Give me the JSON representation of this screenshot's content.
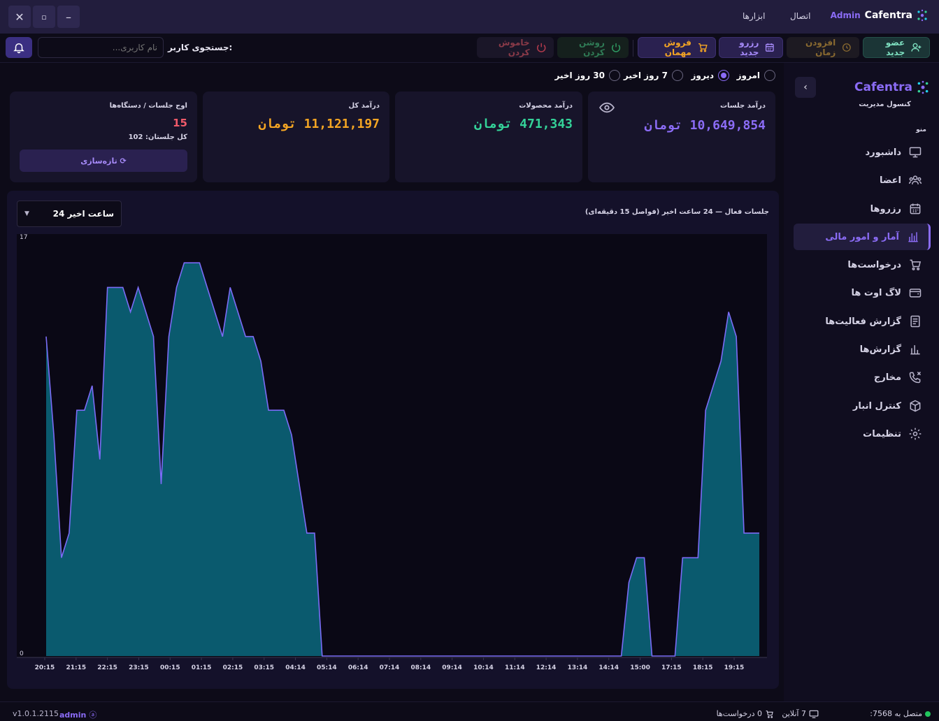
{
  "titlebar": {
    "brand_name": "Cafentra",
    "brand_role": "Admin",
    "menu": [
      "اتصال",
      "ابزارها"
    ],
    "window_controls": [
      "close",
      "maximize",
      "minimize"
    ]
  },
  "toolbar": {
    "new_member": "عضو جدید",
    "add_time": "افزودن زمان",
    "new_reservation": "رزرو جدید",
    "guest_sale": "فروش مهمان",
    "turn_on": "روشن کردن",
    "turn_off": "خاموش کردن",
    "search_label": "جستجوی کاربر:",
    "search_placeholder": "نام کاربری..."
  },
  "sidebar": {
    "brand": "Cafentra",
    "subtitle": "کنسول مدیریت",
    "collapse": "‹",
    "section": "منو",
    "items": [
      {
        "label": "داشبورد",
        "icon": "monitor-icon"
      },
      {
        "label": "اعضا",
        "icon": "users-icon"
      },
      {
        "label": "رزروها",
        "icon": "calendar-icon"
      },
      {
        "label": "آمار و امور مالی",
        "icon": "bar-chart-icon",
        "active": true
      },
      {
        "label": "درخواست‌ها",
        "icon": "cart-icon"
      },
      {
        "label": "لاگ اوت ها",
        "icon": "wallet-icon"
      },
      {
        "label": "گزارش فعالیت‌ها",
        "icon": "report-icon"
      },
      {
        "label": "گزارش‌ها",
        "icon": "stats-icon"
      },
      {
        "label": "مخارج",
        "icon": "phone-x-icon"
      },
      {
        "label": "کنترل انبار",
        "icon": "box-icon"
      },
      {
        "label": "تنظیمات",
        "icon": "gear-icon"
      }
    ]
  },
  "periods": [
    {
      "label": "امروز",
      "selected": false
    },
    {
      "label": "دیروز",
      "selected": true
    },
    {
      "label": "7 روز اخیر",
      "selected": false
    },
    {
      "label": "30 روز اخیر",
      "selected": false
    }
  ],
  "cards": {
    "session_revenue": {
      "title": "درآمد جلسات",
      "value": "10,649,854 تومان",
      "color": "#8b6cf6"
    },
    "product_revenue": {
      "title": "درآمد محصولات",
      "value": "471,343 تومان",
      "color": "#34d399"
    },
    "total_revenue": {
      "title": "درآمد کل",
      "value": "11,121,197 تومان",
      "color": "#f5a623"
    },
    "peak": {
      "title": "اوج جلسات / دستگاه‌ها",
      "value": "15",
      "total": "کل جلستان: 102",
      "refresh": "⟳ تازه‌سازی",
      "color": "#f05a6a"
    }
  },
  "chart_panel": {
    "title": "جلسات فعال — 24 ساعت اخیر (فواصل 15 دقیقه‌ای)",
    "range": "24 ساعت اخیر"
  },
  "chart_data": {
    "type": "area",
    "title": "جلسات فعال — 24 ساعت اخیر (فواصل 15 دقیقه‌ای)",
    "ylim": [
      0,
      17
    ],
    "y_ticks": [
      "0",
      "17"
    ],
    "x_ticks": [
      "20:15",
      "21:15",
      "22:15",
      "23:15",
      "00:15",
      "01:15",
      "02:15",
      "03:15",
      "04:14",
      "05:14",
      "06:14",
      "07:14",
      "08:14",
      "09:14",
      "10:14",
      "11:14",
      "12:14",
      "13:14",
      "14:14",
      "15:00",
      "17:15",
      "18:15",
      "19:15"
    ],
    "series": [
      {
        "color": "#7b6cf6",
        "fill": "#0a5a6e",
        "values": [
          13,
          9,
          4,
          5,
          10,
          10,
          11,
          8,
          15,
          15,
          15,
          14,
          15,
          14,
          13,
          7,
          13,
          15,
          16,
          16,
          16,
          15,
          14,
          13,
          15,
          14,
          13,
          13,
          12,
          10,
          10,
          10,
          9,
          7,
          5,
          5,
          0,
          0,
          0,
          0,
          0,
          0,
          0,
          0,
          0,
          0,
          0,
          0,
          0,
          0,
          0,
          0,
          0,
          0,
          0,
          0,
          0,
          0,
          0,
          0,
          0,
          0,
          0,
          0,
          0,
          0,
          0,
          0,
          0,
          0,
          0,
          0,
          0,
          0,
          0,
          0,
          3,
          4,
          4,
          0,
          0,
          0,
          0,
          4,
          4,
          4,
          10,
          11,
          12,
          14,
          13,
          5,
          5,
          5
        ]
      }
    ]
  },
  "statusbar": {
    "connected": "متصل به 7568:",
    "online": "7 آنلاین",
    "requests": "0 درخواست‌ها",
    "user": "admin",
    "version": "v1.0.1.2115",
    "connected_color": "#22c55e"
  }
}
